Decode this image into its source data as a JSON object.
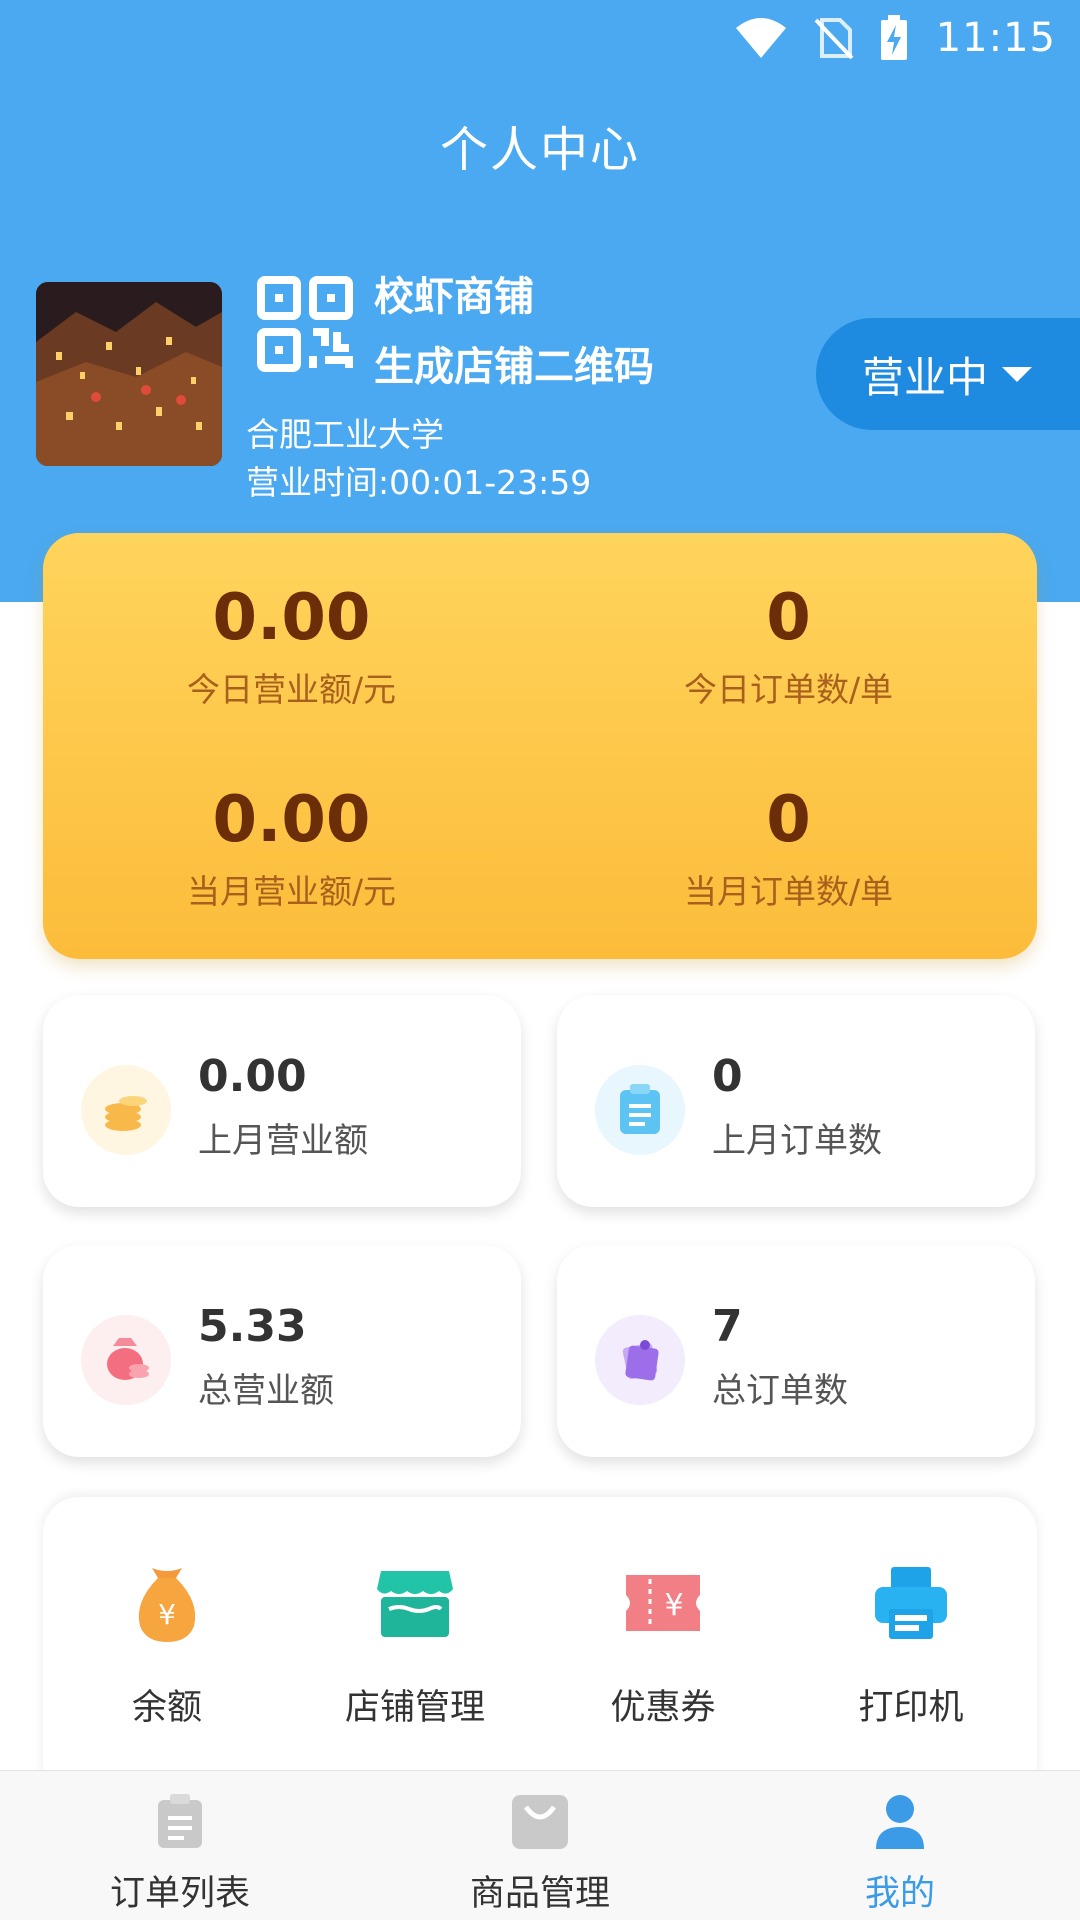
{
  "status_bar": {
    "time": "11:15"
  },
  "header": {
    "title": "个人中心"
  },
  "store": {
    "name": "校虾商铺",
    "qr_label": "生成店铺二维码",
    "school": "合肥工业大学",
    "hours": "营业时间:00:01-23:59",
    "status": "营业中"
  },
  "stats": {
    "today_revenue": {
      "value": "0.00",
      "label": "今日营业额/元"
    },
    "today_orders": {
      "value": "0",
      "label": "今日订单数/单"
    },
    "month_revenue": {
      "value": "0.00",
      "label": "当月营业额/元"
    },
    "month_orders": {
      "value": "0",
      "label": "当月订单数/单"
    }
  },
  "cards": [
    {
      "value": "0.00",
      "label": "上月营业额",
      "icon": "coins-icon"
    },
    {
      "value": "0",
      "label": "上月订单数",
      "icon": "clipboard-icon"
    },
    {
      "value": "5.33",
      "label": "总营业额",
      "icon": "money-bag-icon"
    },
    {
      "value": "7",
      "label": "总订单数",
      "icon": "notes-icon"
    }
  ],
  "menu": [
    {
      "label": "余额",
      "icon": "money-bag-icon"
    },
    {
      "label": "店铺管理",
      "icon": "store-icon"
    },
    {
      "label": "优惠券",
      "icon": "coupon-icon"
    },
    {
      "label": "打印机",
      "icon": "printer-icon"
    }
  ],
  "bottom_nav": [
    {
      "label": "订单列表",
      "icon": "order-list-icon"
    },
    {
      "label": "商品管理",
      "icon": "shopping-bag-icon"
    },
    {
      "label": "我的",
      "icon": "user-icon",
      "active": true
    }
  ],
  "colors": {
    "header_blue": "#4aa9f0",
    "status_pill": "#1f8be0",
    "stats_card": "#fcbc3a",
    "stat_number": "#6b2e09",
    "active_tab": "#3b9be6"
  }
}
